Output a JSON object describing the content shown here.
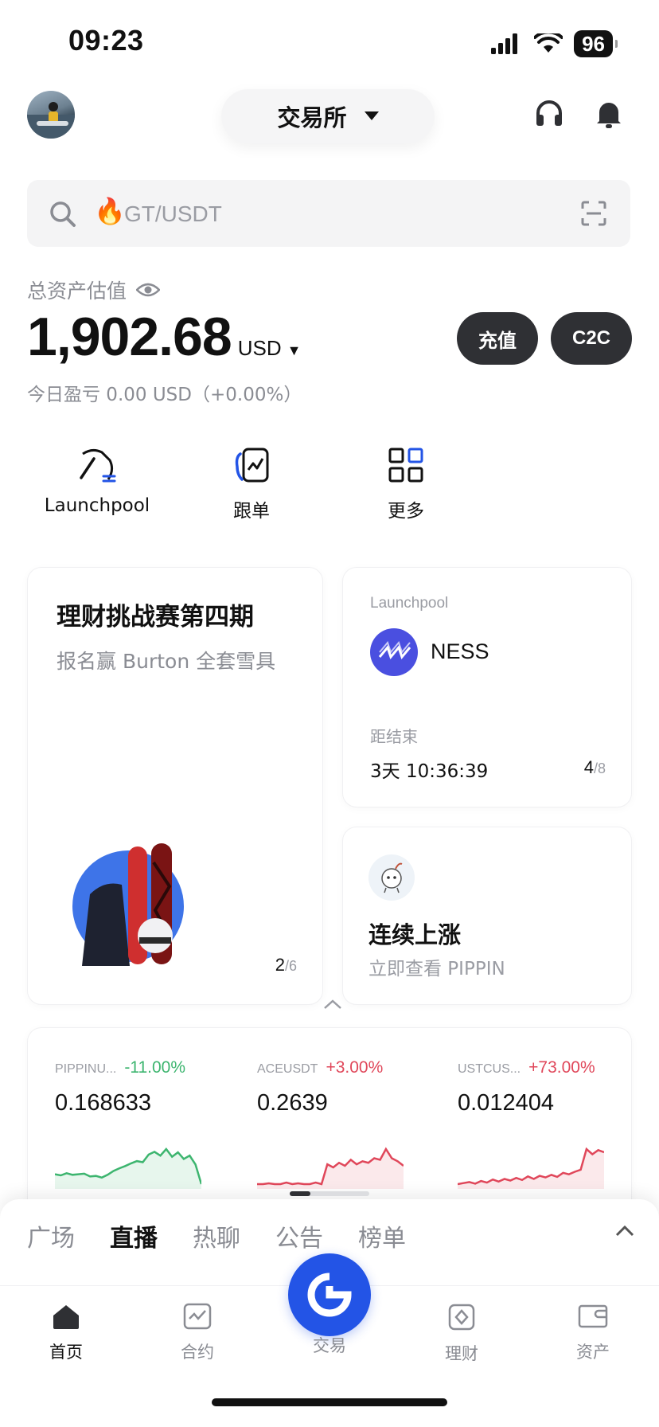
{
  "status_bar": {
    "time": "09:23",
    "battery": "96"
  },
  "header": {
    "exchange_label": "交易所"
  },
  "search": {
    "placeholder": "GT/USDT"
  },
  "assets": {
    "title": "总资产估值",
    "value": "1,902.68",
    "unit": "USD",
    "pnl": "今日盈亏 0.00 USD（+0.00%）",
    "deposit_label": "充值",
    "c2c_label": "C2C"
  },
  "quick_actions": [
    {
      "label": "Launchpool",
      "icon": "pickaxe-icon"
    },
    {
      "label": "跟单",
      "icon": "copy-trade-icon"
    },
    {
      "label": "更多",
      "icon": "grid-icon"
    }
  ],
  "promo_card": {
    "title": "理财挑战赛第四期",
    "subtitle": "报名赢 Burton 全套雪具",
    "page": "2",
    "total": "/6"
  },
  "launchpool_card": {
    "tag": "Launchpool",
    "token": "NESS",
    "countdown_label": "距结束",
    "countdown": "3天 10:36:39",
    "page": "4",
    "total": "/8"
  },
  "trend_card": {
    "title": "连续上涨",
    "subtitle": "立即查看 PIPPIN"
  },
  "tickers": [
    {
      "symbol": "PIPPINU...",
      "change": "-11.00%",
      "price": "0.168633",
      "color": "#3db56f",
      "spark": [
        5,
        4.8,
        5.2,
        4.9,
        5,
        5.1,
        4.6,
        4.7,
        4.4,
        4.9,
        5.6,
        6.1,
        6.5,
        7,
        7.4,
        7.2,
        8.6,
        9.1,
        8.4,
        9.6,
        8.2,
        9.0,
        7.8,
        8.4,
        6.8,
        3.2
      ]
    },
    {
      "symbol": "ACEUSDT",
      "change": "+3.00%",
      "price": "0.2639",
      "color": "#e0475a",
      "spark": [
        5,
        5,
        5.1,
        5,
        5,
        5.2,
        5,
        5.1,
        5,
        5,
        5.2,
        5,
        7.6,
        7.2,
        7.8,
        7.4,
        8.2,
        7.6,
        8.0,
        7.8,
        8.4,
        8.2,
        9.6,
        8.4,
        8.0,
        7.4
      ]
    },
    {
      "symbol": "USTCUS...",
      "change": "+73.00%",
      "price": "0.012404",
      "color": "#e0475a",
      "spark": [
        4,
        4.2,
        4.4,
        4.1,
        4.6,
        4.3,
        4.9,
        4.5,
        5.0,
        4.7,
        5.2,
        4.8,
        5.5,
        5.0,
        5.6,
        5.3,
        5.8,
        5.4,
        6.2,
        5.9,
        6.4,
        6.8,
        10.8,
        9.8,
        10.6,
        10.2
      ]
    }
  ],
  "feed_tabs": [
    "广场",
    "直播",
    "热聊",
    "公告",
    "榜单"
  ],
  "feed_active": 1,
  "bottom_nav": [
    {
      "label": "首页",
      "icon": "home-icon",
      "active": true
    },
    {
      "label": "合约",
      "icon": "futures-icon",
      "active": false
    },
    {
      "label": "交易",
      "icon": "trade-icon",
      "active": false
    },
    {
      "label": "理财",
      "icon": "earn-icon",
      "active": false
    },
    {
      "label": "资产",
      "icon": "wallet-icon",
      "active": false
    }
  ]
}
